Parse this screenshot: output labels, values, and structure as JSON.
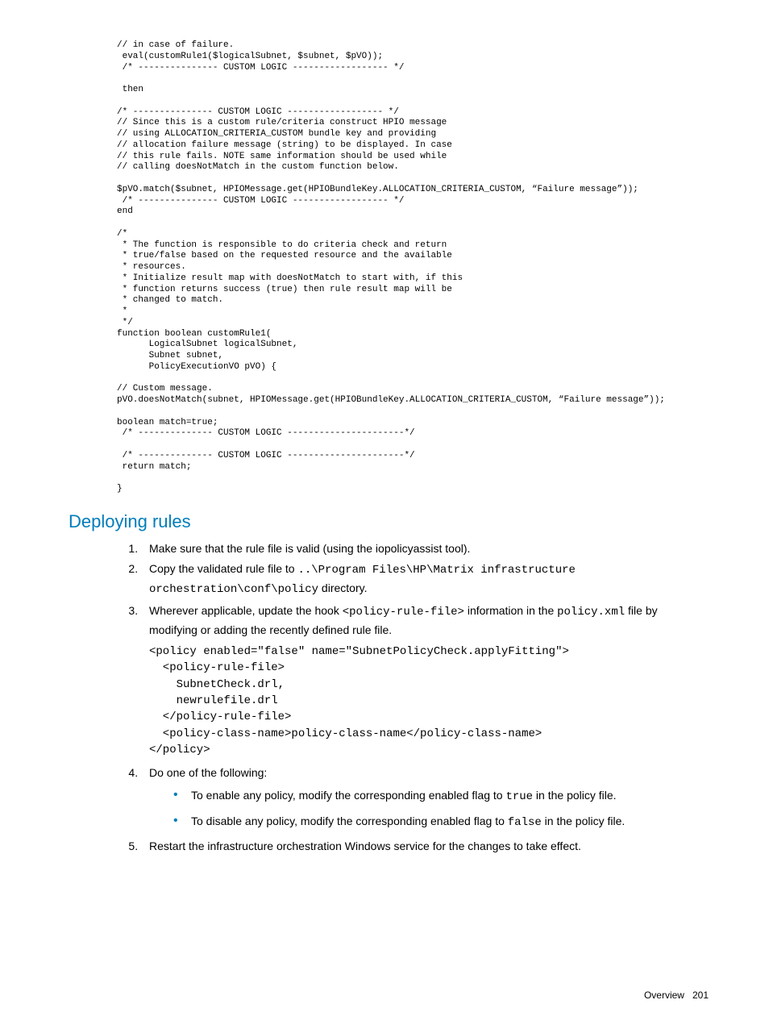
{
  "code_block_top": "// in case of failure.\n eval(customRule1($logicalSubnet, $subnet, $pVO));\n /* --------------- CUSTOM LOGIC ------------------ */\n\n then\n\n/* --------------- CUSTOM LOGIC ------------------ */\n// Since this is a custom rule/criteria construct HPIO message\n// using ALLOCATION_CRITERIA_CUSTOM bundle key and providing\n// allocation failure message (string) to be displayed. In case\n// this rule fails. NOTE same information should be used while\n// calling doesNotMatch in the custom function below.\n\n$pVO.match($subnet, HPIOMessage.get(HPIOBundleKey.ALLOCATION_CRITERIA_CUSTOM, “Failure message”));\n /* --------------- CUSTOM LOGIC ------------------ */\nend\n\n/*\n * The function is responsible to do criteria check and return\n * true/false based on the requested resource and the available\n * resources.\n * Initialize result map with doesNotMatch to start with, if this\n * function returns success (true) then rule result map will be\n * changed to match.\n *\n */\nfunction boolean customRule1(\n      LogicalSubnet logicalSubnet,\n      Subnet subnet,\n      PolicyExecutionVO pVO) {\n\n// Custom message.\npVO.doesNotMatch(subnet, HPIOMessage.get(HPIOBundleKey.ALLOCATION_CRITERIA_CUSTOM, “Failure message”));\n\nboolean match=true;\n /* -------------- CUSTOM LOGIC ----------------------*/\n\n /* -------------- CUSTOM LOGIC ----------------------*/\n return match;\n\n}",
  "heading": "Deploying rules",
  "steps": {
    "s1": "Make sure that the rule file is valid (using the iopolicyassist tool).",
    "s2_pre": "Copy the validated rule file to ",
    "s2_code": "..\\Program Files\\HP\\Matrix infrastructure orchestration\\conf\\policy",
    "s2_post": " directory.",
    "s3_pre": "Wherever applicable, update the hook ",
    "s3_code1": "<policy-rule-file>",
    "s3_mid": " information in the ",
    "s3_code2": "policy.xml",
    "s3_post": " file by modifying or adding the recently defined rule file.",
    "s3_block": "<policy enabled=\"false\" name=\"SubnetPolicyCheck.applyFitting\">\n  <policy-rule-file>\n    SubnetCheck.drl,\n    newrulefile.drl\n  </policy-rule-file>\n  <policy-class-name>policy-class-name</policy-class-name>\n</policy>",
    "s4_intro": "Do one of the following:",
    "s4_b1_pre": "To enable any policy, modify the corresponding enabled flag to ",
    "s4_b1_code": "true",
    "s4_b1_post": " in the policy file.",
    "s4_b2_pre": "To disable any policy, modify the corresponding enabled flag to ",
    "s4_b2_code": "false",
    "s4_b2_post": " in the policy file.",
    "s5": "Restart the infrastructure orchestration Windows service for the changes to take effect."
  },
  "footer": {
    "label": "Overview",
    "page": "201"
  }
}
